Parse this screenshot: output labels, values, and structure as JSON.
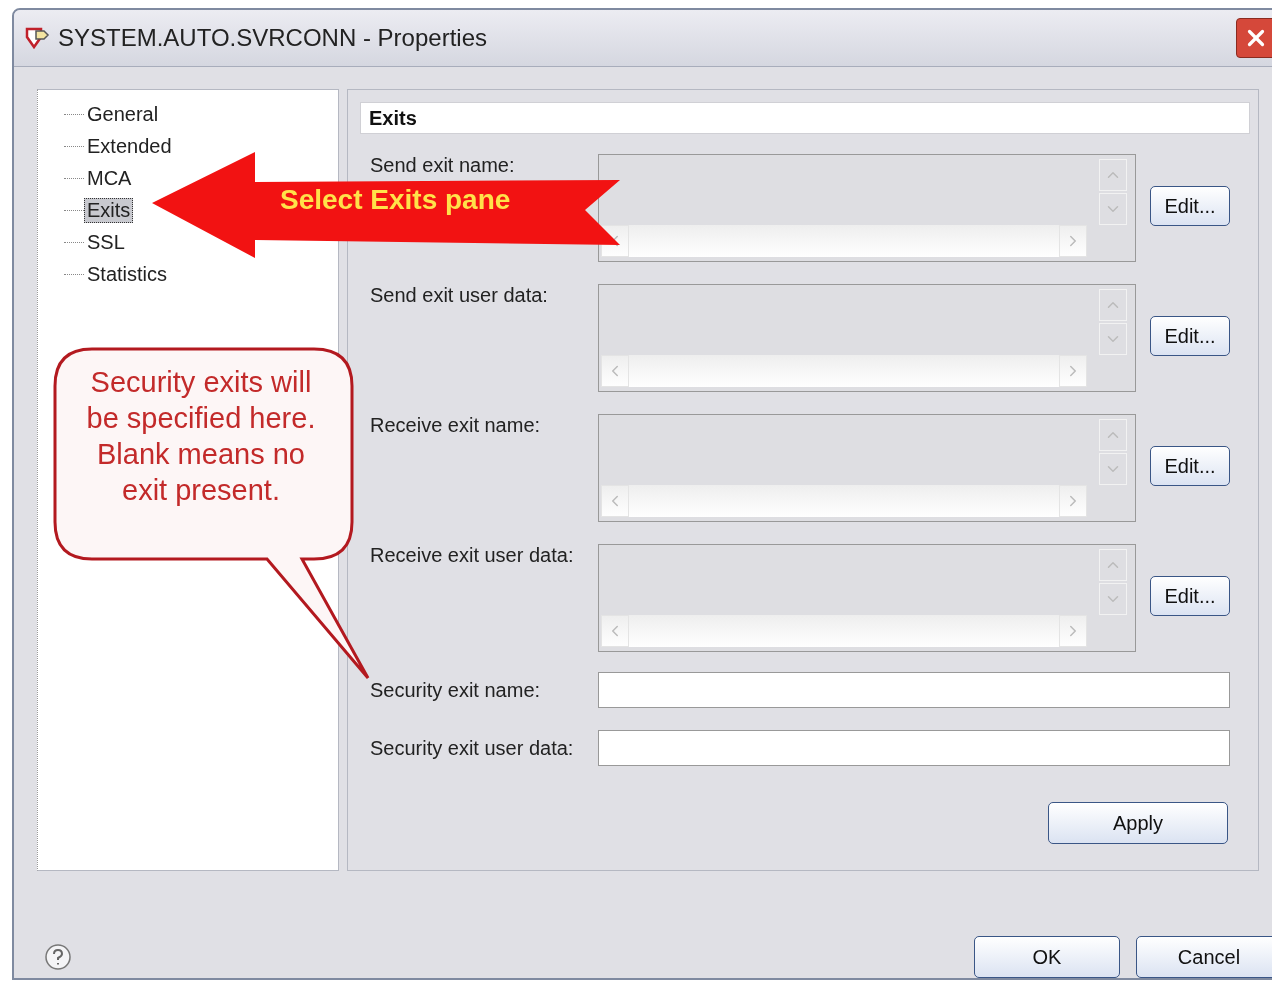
{
  "window": {
    "title": "SYSTEM.AUTO.SVRCONN - Properties"
  },
  "tree": {
    "items": [
      {
        "label": "General",
        "selected": false
      },
      {
        "label": "Extended",
        "selected": false
      },
      {
        "label": "MCA",
        "selected": false
      },
      {
        "label": "Exits",
        "selected": true
      },
      {
        "label": "SSL",
        "selected": false
      },
      {
        "label": "Statistics",
        "selected": false
      }
    ]
  },
  "pane": {
    "heading": "Exits",
    "list_fields": [
      {
        "label": "Send exit name:",
        "button": "Edit..."
      },
      {
        "label": "Send exit user data:",
        "button": "Edit..."
      },
      {
        "label": "Receive exit name:",
        "button": "Edit..."
      },
      {
        "label": "Receive exit user data:",
        "button": "Edit..."
      }
    ],
    "text_fields": [
      {
        "label": "Security exit name:"
      },
      {
        "label": "Security exit user data:"
      }
    ],
    "apply_button": "Apply"
  },
  "buttons": [
    "OK",
    "Cancel"
  ],
  "annotations": [
    {
      "kind": "arrow",
      "text": "Select Exits pane"
    },
    {
      "kind": "callout",
      "text": "Security exits will be specified here.  Blank means no exit present."
    }
  ]
}
